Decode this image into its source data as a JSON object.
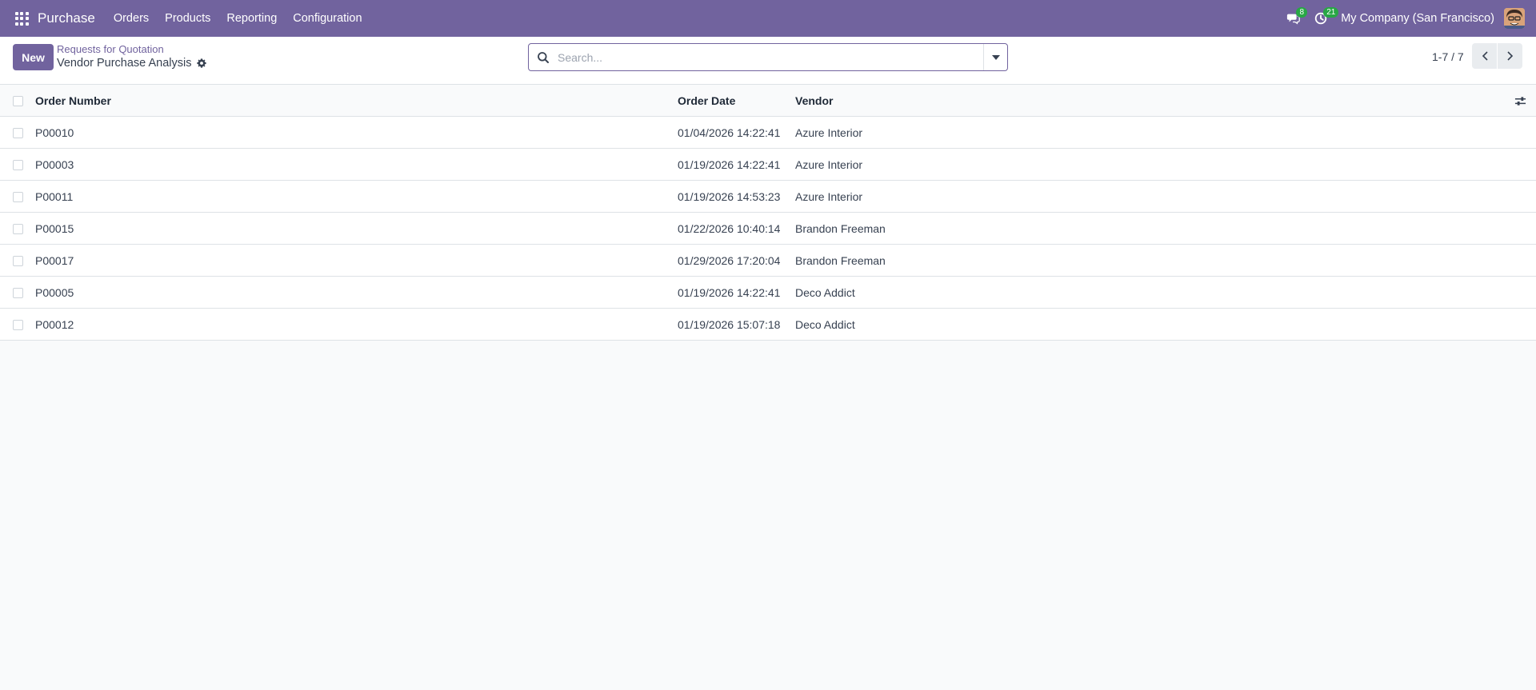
{
  "navbar": {
    "app_name": "Purchase",
    "menu": [
      "Orders",
      "Products",
      "Reporting",
      "Configuration"
    ],
    "messages_count": "8",
    "activities_count": "21",
    "company": "My Company (San Francisco)"
  },
  "control": {
    "new_label": "New",
    "breadcrumb_parent": "Requests for Quotation",
    "breadcrumb_current": "Vendor Purchase Analysis",
    "search_placeholder": "Search...",
    "pager": "1-7 / 7"
  },
  "table": {
    "columns": {
      "order_number": "Order Number",
      "order_date": "Order Date",
      "vendor": "Vendor"
    },
    "rows": [
      {
        "number": "P00010",
        "date": "01/04/2026 14:22:41",
        "vendor": "Azure Interior"
      },
      {
        "number": "P00003",
        "date": "01/19/2026 14:22:41",
        "vendor": "Azure Interior"
      },
      {
        "number": "P00011",
        "date": "01/19/2026 14:53:23",
        "vendor": "Azure Interior"
      },
      {
        "number": "P00015",
        "date": "01/22/2026 10:40:14",
        "vendor": "Brandon Freeman"
      },
      {
        "number": "P00017",
        "date": "01/29/2026 17:20:04",
        "vendor": "Brandon Freeman"
      },
      {
        "number": "P00005",
        "date": "01/19/2026 14:22:41",
        "vendor": "Deco Addict"
      },
      {
        "number": "P00012",
        "date": "01/19/2026 15:07:18",
        "vendor": "Deco Addict"
      }
    ]
  },
  "colors": {
    "brand": "#71639e",
    "badge": "#28a745"
  }
}
